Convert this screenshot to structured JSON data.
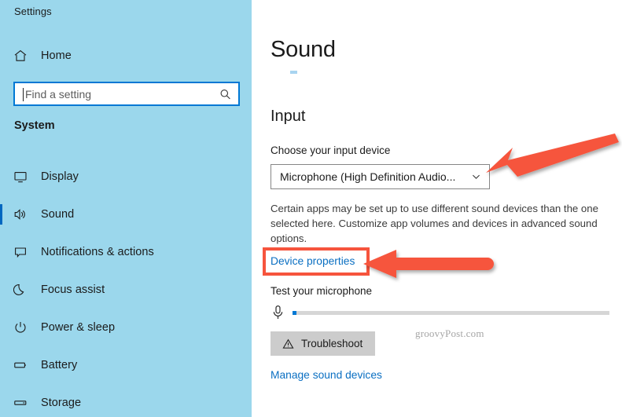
{
  "window": {
    "title": "Settings"
  },
  "sidebar": {
    "home": {
      "label": "Home",
      "icon": "home-icon"
    },
    "search": {
      "placeholder": "Find a setting",
      "value": "",
      "icon": "search-icon"
    },
    "group_title": "System",
    "items": [
      {
        "label": "Display",
        "icon": "monitor-icon",
        "selected": false
      },
      {
        "label": "Sound",
        "icon": "speaker-icon",
        "selected": true
      },
      {
        "label": "Notifications & actions",
        "icon": "notification-icon",
        "selected": false
      },
      {
        "label": "Focus assist",
        "icon": "moon-icon",
        "selected": false
      },
      {
        "label": "Power & sleep",
        "icon": "power-icon",
        "selected": false
      },
      {
        "label": "Battery",
        "icon": "battery-icon",
        "selected": false
      },
      {
        "label": "Storage",
        "icon": "storage-icon",
        "selected": false
      }
    ]
  },
  "main": {
    "page_title": "Sound",
    "input_section": {
      "heading": "Input",
      "choose_label": "Choose your input device",
      "device_value": "Microphone (High Definition Audio...",
      "device_chevron": "chevron-down-icon",
      "description": "Certain apps may be set up to use different sound devices than the one selected here. Customize app volumes and devices in advanced sound options.",
      "device_properties_link": "Device properties",
      "test_mic_label": "Test your microphone",
      "mic_icon": "microphone-icon",
      "mic_level_percent": 1,
      "troubleshoot_label": "Troubleshoot",
      "troubleshoot_icon": "warning-triangle-icon",
      "manage_link": "Manage sound devices"
    }
  },
  "watermark": "groovyPost.com",
  "annotations": {
    "highlight_color": "#f6543d",
    "arrow_color": "#f6543d",
    "accent_color": "#0078d4",
    "link_color": "#0a6fc2",
    "sidebar_color": "#9bd7ec"
  }
}
